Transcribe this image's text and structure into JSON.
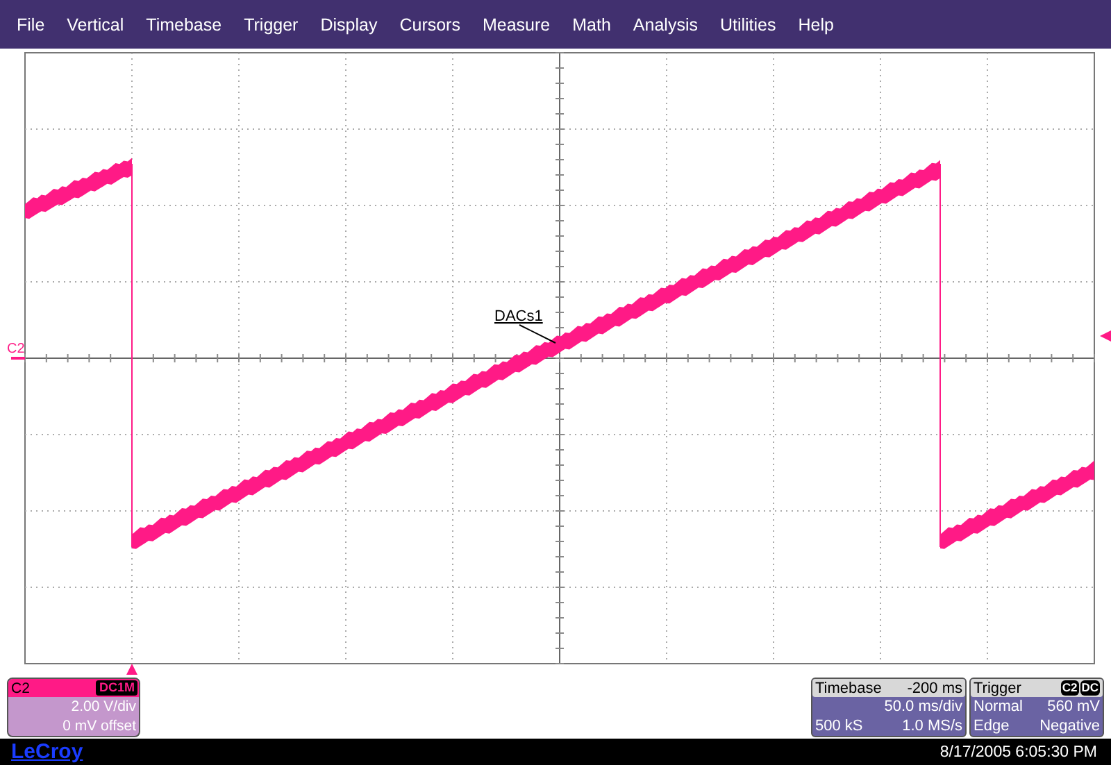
{
  "menu": [
    "File",
    "Vertical",
    "Timebase",
    "Trigger",
    "Display",
    "Cursors",
    "Measure",
    "Math",
    "Analysis",
    "Utilities",
    "Help"
  ],
  "graticule": {
    "channel_marker": "C2",
    "annotation": "DACs1"
  },
  "channel_panel": {
    "label": "C2",
    "coupling": "DC1M",
    "scale": "2.00 V/div",
    "offset": "0 mV offset"
  },
  "timebase_panel": {
    "title": "Timebase",
    "delay": "-200 ms",
    "scale": "50.0 ms/div",
    "samples": "500 kS",
    "rate": "1.0 MS/s"
  },
  "trigger_panel": {
    "title": "Trigger",
    "source": "C2",
    "coupling": "DC",
    "mode": "Normal",
    "level": "560 mV",
    "type": "Edge",
    "slope": "Negative"
  },
  "status_bar": {
    "brand": "LeCroy",
    "datetime": "8/17/2005 6:05:30 PM"
  }
}
